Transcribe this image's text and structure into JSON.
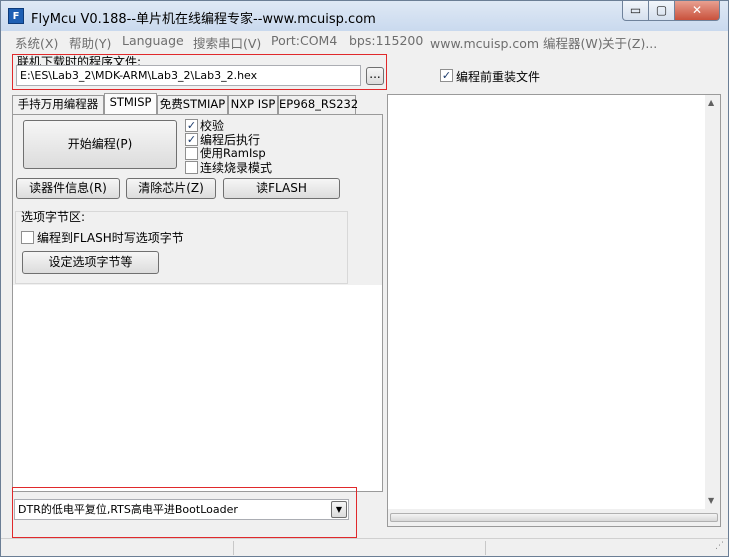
{
  "window": {
    "title": "FlyMcu V0.188--单片机在线编程专家--www.mcuisp.com",
    "min_symbol": "▭",
    "max_symbol": "▢",
    "close_symbol": "✕"
  },
  "menu": [
    {
      "label": "系统(X)"
    },
    {
      "label": "帮助(Y)"
    },
    {
      "label": "Language"
    },
    {
      "label": "搜索串口(V)"
    },
    {
      "label": "Port:COM4"
    },
    {
      "label": "bps:115200"
    },
    {
      "label": "www.mcuisp.com 编程器(W)"
    },
    {
      "label": "关于(Z)..."
    }
  ],
  "file": {
    "label": "联机下载时的程序文件:",
    "path": "E:\\ES\\Lab3_2\\MDK-ARM\\Lab3_2\\Lab3_2.hex",
    "browse_label": "...",
    "reload_label": "编程前重装文件",
    "reload_checked": "✓"
  },
  "tabs": [
    {
      "label": "手持万用编程器"
    },
    {
      "label": "STMISP"
    },
    {
      "label": "免费STMIAP"
    },
    {
      "label": "NXP ISP"
    },
    {
      "label": "EP968_RS232"
    }
  ],
  "stmisp": {
    "start_button": "开始编程(P)",
    "options": [
      {
        "label": "校验",
        "mark": "✓"
      },
      {
        "label": "编程后执行",
        "mark": "✓"
      },
      {
        "label": "使用RamIsp",
        "mark": ""
      },
      {
        "label": "连续烧录模式",
        "mark": ""
      }
    ],
    "read_info_button": "读器件信息(R)",
    "erase_button": "清除芯片(Z)",
    "read_flash_button": "读FLASH",
    "option_bytes": {
      "group_label": "选项字节区:",
      "write_label": "编程到FLASH时写选项字节",
      "set_button": "设定选项字节等"
    }
  },
  "reset_mode": {
    "selected": "DTR的低电平复位,RTS高电平进BootLoader",
    "arrow": "▼"
  },
  "scroll": {
    "up": "▲",
    "down": "▼"
  }
}
